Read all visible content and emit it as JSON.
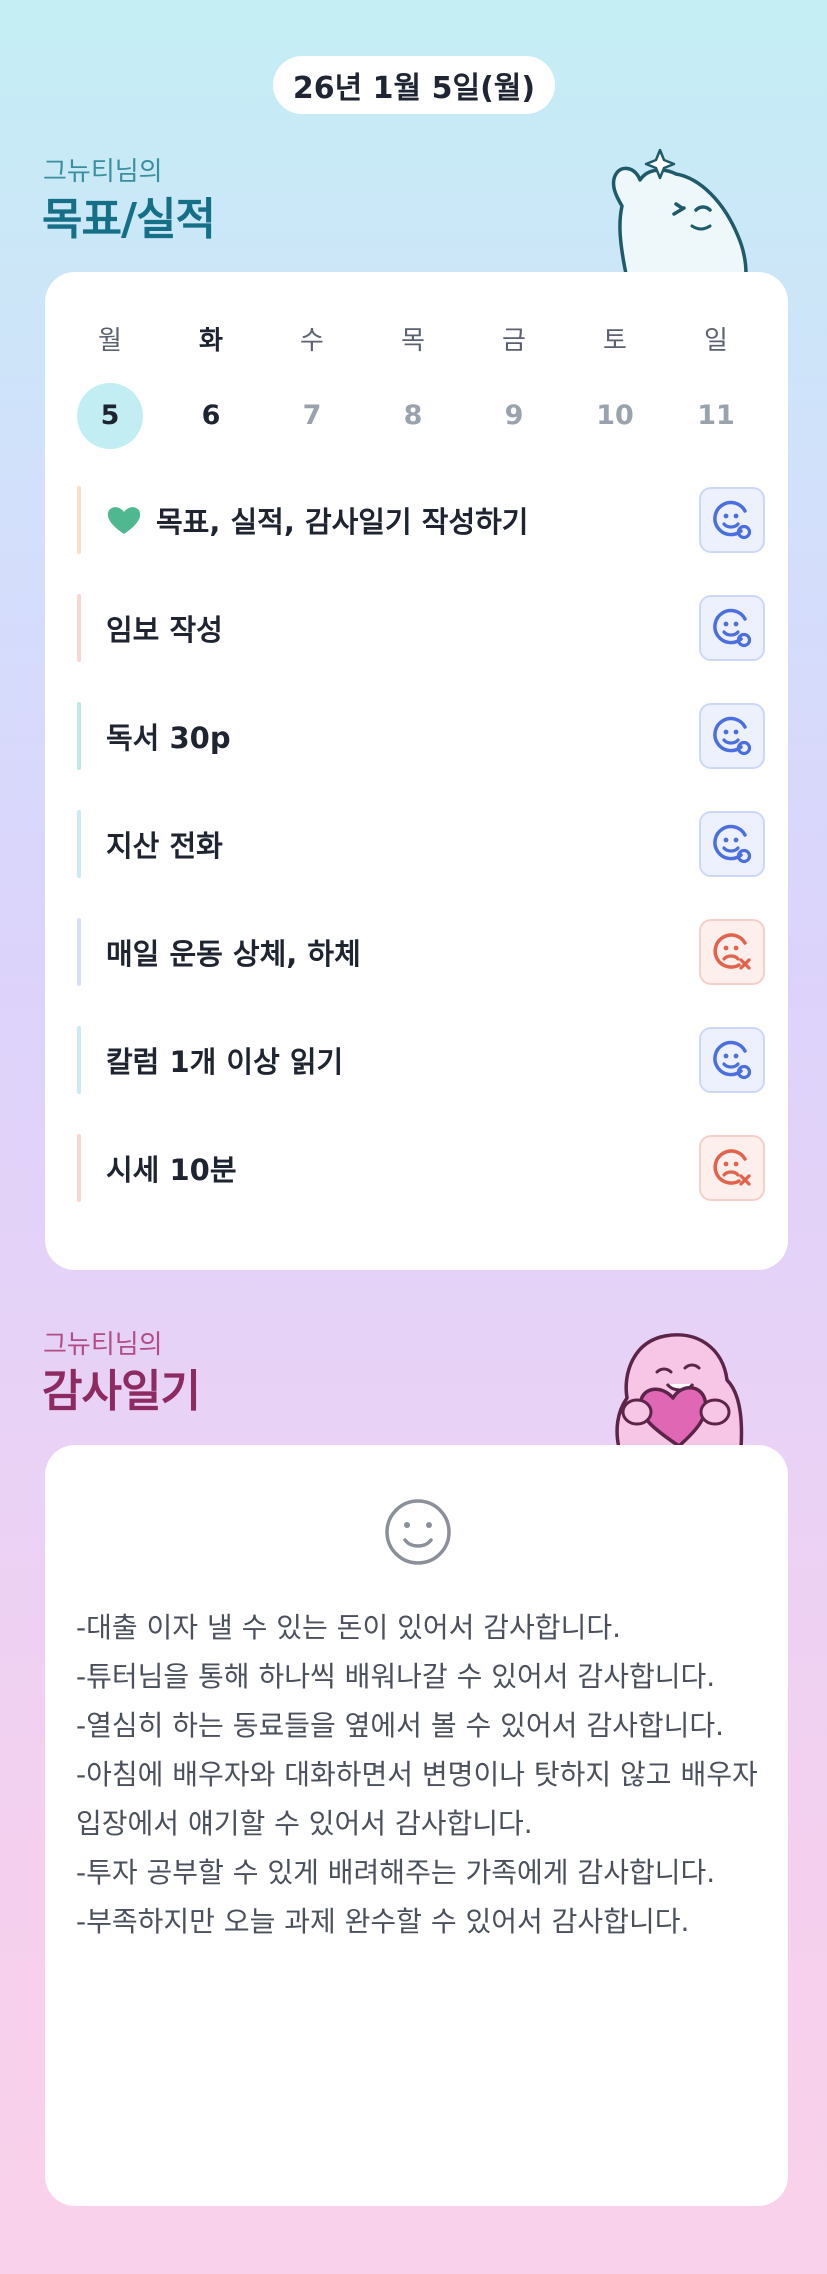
{
  "header": {
    "date": "26년 1월 5일(월)"
  },
  "goals_section": {
    "subtitle": "그뉴티님의",
    "title": "목표/실적",
    "week": [
      {
        "day": "월",
        "num": "5"
      },
      {
        "day": "화",
        "num": "6"
      },
      {
        "day": "수",
        "num": "7"
      },
      {
        "day": "목",
        "num": "8"
      },
      {
        "day": "금",
        "num": "9"
      },
      {
        "day": "토",
        "num": "10"
      },
      {
        "day": "일",
        "num": "11"
      }
    ],
    "items": [
      {
        "label": "목표, 실적, 감사일기 작성하기",
        "status": "done",
        "bar_color": "#f9dfc7",
        "icon": "heart-icon"
      },
      {
        "label": "임보 작성",
        "status": "done",
        "bar_color": "#f9d6cf"
      },
      {
        "label": "독서 30p",
        "status": "done",
        "bar_color": "#bfe9e4"
      },
      {
        "label": "지산 전화",
        "status": "done",
        "bar_color": "#c9eaf6"
      },
      {
        "label": "매일 운동 상체, 하체",
        "status": "fail",
        "bar_color": "#d6e0f6"
      },
      {
        "label": "칼럼 1개 이상 읽기",
        "status": "done",
        "bar_color": "#c9eaf6"
      },
      {
        "label": "시세 10분",
        "status": "fail",
        "bar_color": "#f9d6cf"
      }
    ]
  },
  "gratitude_section": {
    "subtitle": "그뉴티님의",
    "title": "감사일기",
    "mood_icon": "smile-icon",
    "text": "-대출 이자 낼 수 있는 돈이 있어서 감사합니다.\n-튜터님을 통해 하나씩 배워나갈 수 있어서 감사합니다.\n-열심히 하는 동료들을 옆에서 볼 수 있어서 감사합니다.\n-아침에 배우자와 대화하면서 변명이나 탓하지 않고 배우자 입장에서 얘기할 수 있어서 감사합니다.\n-투자 공부할 수 있게 배려해주는 가족에게 감사합니다.\n-부족하지만 오늘 과제 완수할 수 있어서 감사합니다."
  },
  "colors": {
    "done_icon": "#4b6fe0",
    "fail_icon": "#e2624b",
    "goal_title": "#156f86",
    "gratitude_title": "#8e2a62",
    "selected_day_bg": "#c2eef3"
  }
}
